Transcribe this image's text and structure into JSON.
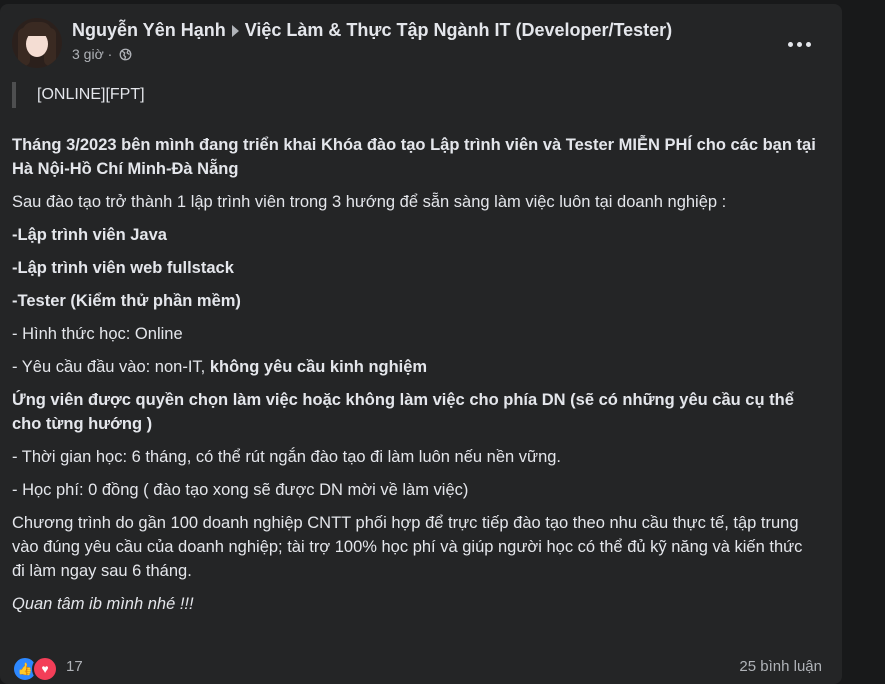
{
  "post": {
    "author": "Nguyễn Yên Hạnh",
    "group": "Việc Làm & Thực Tập Ngành IT (Developer/Tester)",
    "time": "3 giờ",
    "separator": "·",
    "privacy_icon": "globe-icon",
    "more_icon": "more-horizontal-icon",
    "quote_tag": "[ONLINE][FPT]",
    "paragraphs": {
      "intro": "Tháng 3/2023 bên mình đang triển khai Khóa đào tạo Lập trình viên và Tester MIỄN PHÍ cho các bạn tại Hà Nội-Hồ Chí Minh-Đà Nẵng",
      "after_training": "Sau đào tạo trở thành 1 lập trình viên trong 3 hướng để sẵn sàng làm việc luôn tại doanh nghiệp :",
      "track_java": "-Lập trình viên Java",
      "track_web": "-Lập trình viên web fullstack",
      "track_tester": "-Tester (Kiểm thử phần mềm)",
      "study_mode": "- Hình thức học: Online",
      "requirement_prefix": "- Yêu cầu đầu vào: non-IT, ",
      "requirement_bold": "không yêu cầu kinh nghiệm",
      "candidate_choice": "Ứng viên được quyền chọn làm việc hoặc không làm việc cho phía DN (sẽ có những yêu cầu cụ thể cho từng hướng )",
      "duration": "- Thời gian học: 6 tháng, có thể rút ngắn đào tạo đi làm luôn nếu nền vững.",
      "fee": "- Học phí: 0 đồng ( đào tạo xong sẽ được DN mời về làm việc)",
      "program": "Chương trình do gần 100 doanh nghiệp CNTT phối hợp để trực tiếp đào tạo theo nhu cầu thực tế, tập trung vào đúng yêu cầu của doanh nghiệp; tài trợ 100% học phí và giúp người học có thể đủ kỹ năng và kiến thức đi làm ngay sau 6 tháng.",
      "closing": "Quan tâm ib mình nhé !!!"
    },
    "reactions": {
      "like_icon": "like-icon",
      "love_icon": "love-icon",
      "count": "17",
      "comments": "25 bình luận"
    }
  },
  "colors": {
    "background": "#18191a",
    "card": "#242526",
    "text_primary": "#e4e6eb",
    "text_secondary": "#b0b3b8",
    "like_blue": "#2d88ff",
    "love_red": "#f33e58"
  }
}
